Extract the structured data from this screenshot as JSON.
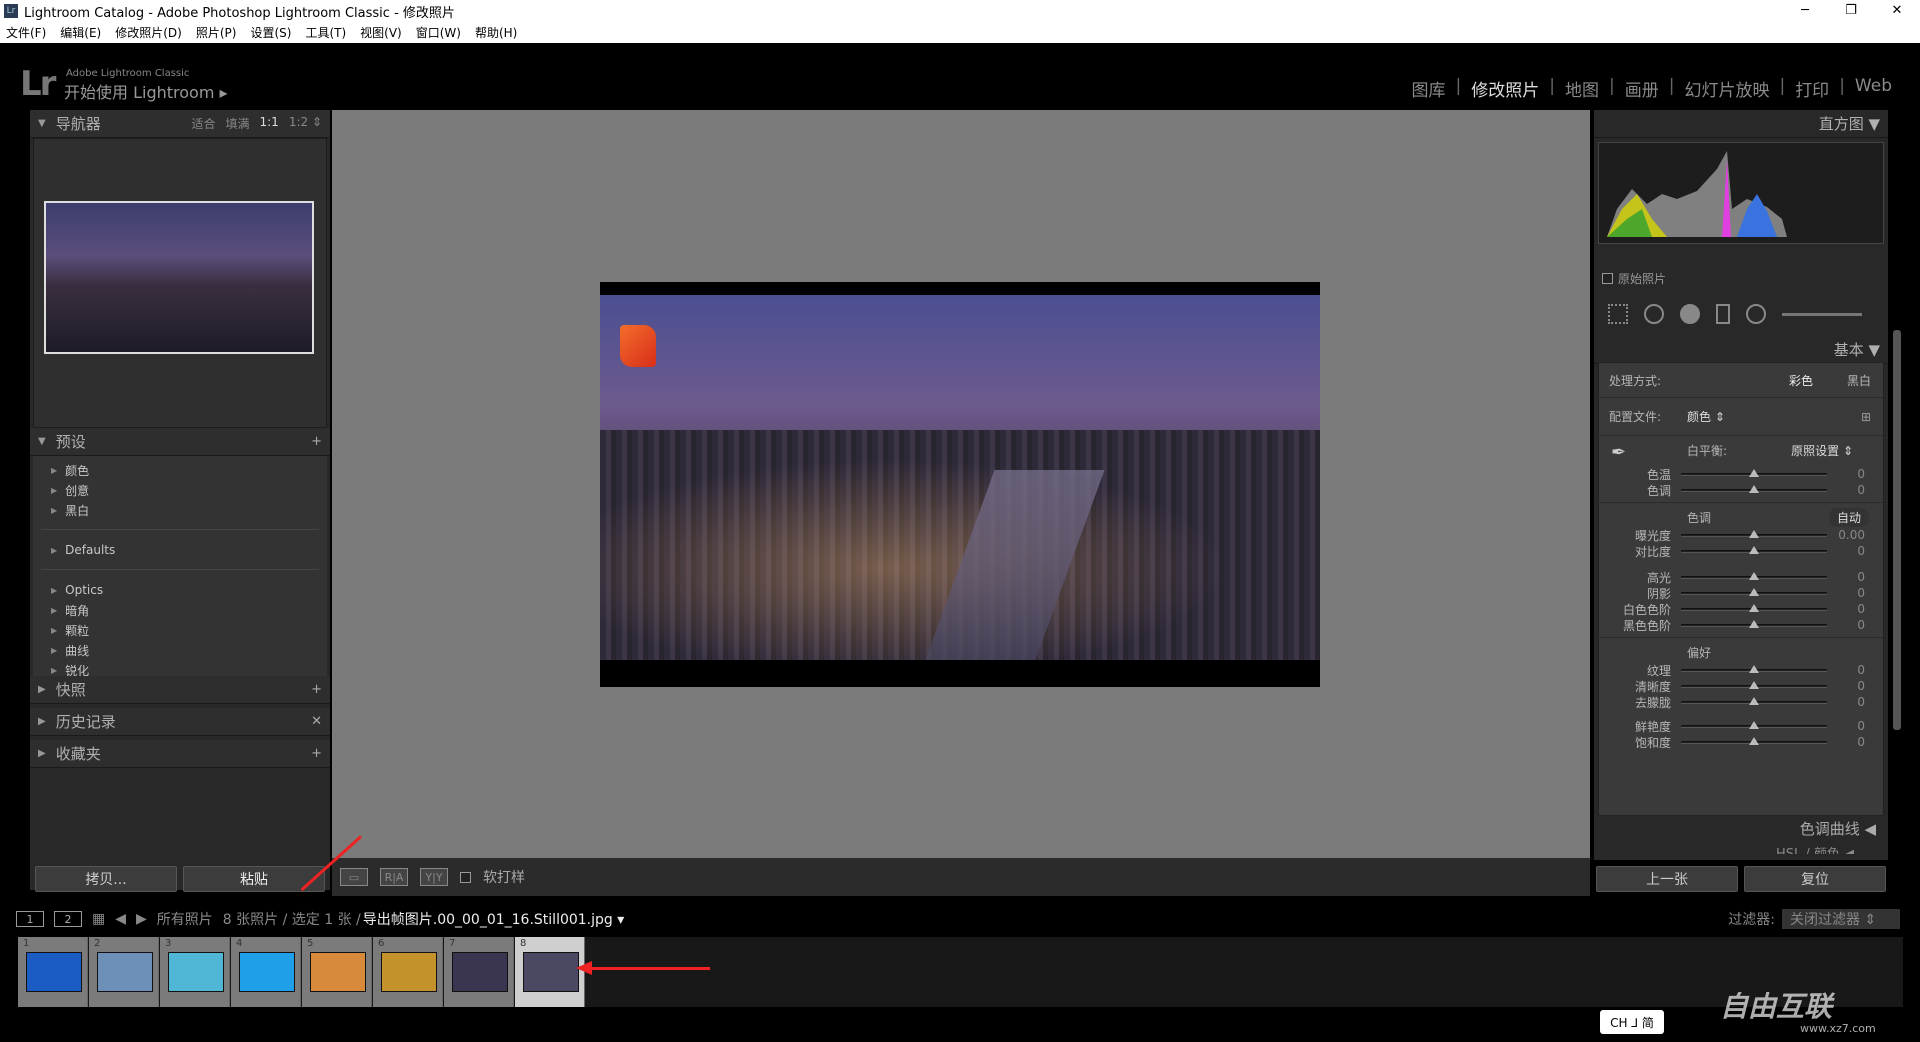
{
  "window": {
    "title": "Lightroom Catalog - Adobe Photoshop Lightroom Classic - 修改照片",
    "app_icon": "Lr",
    "controls": [
      "─",
      "❐",
      "✕"
    ]
  },
  "menu": [
    "文件(F)",
    "编辑(E)",
    "修改照片(D)",
    "照片(P)",
    "设置(S)",
    "工具(T)",
    "视图(V)",
    "窗口(W)",
    "帮助(H)"
  ],
  "header": {
    "logo": "Lr",
    "brand": "Adobe Lightroom Classic",
    "subtitle": "开始使用 Lightroom ▸",
    "modules": [
      "图库",
      "修改照片",
      "地图",
      "画册",
      "幻灯片放映",
      "打印",
      "Web"
    ],
    "active_module": "修改照片"
  },
  "left": {
    "navigator": {
      "title": "导航器",
      "options": [
        "适合",
        "填满",
        "1:1",
        "1:2 ⇕"
      ],
      "active_option": "1:1"
    },
    "presets": {
      "title": "预设",
      "add": "+",
      "groups1": [
        "颜色",
        "创意",
        "黑白"
      ],
      "groups2": [
        "Defaults"
      ],
      "groups3": [
        "Optics",
        "暗角",
        "颗粒",
        "曲线",
        "锐化"
      ]
    },
    "snapshots": {
      "title": "快照",
      "action": "+"
    },
    "history": {
      "title": "历史记录",
      "action": "✕"
    },
    "collections": {
      "title": "收藏夹",
      "action": "+"
    },
    "copy_button": "拷贝...",
    "paste_button": "粘贴"
  },
  "toolbar": {
    "view1": "▭",
    "view2": "R|A",
    "view3": "Y|Y",
    "soft_proof": "软打样"
  },
  "right": {
    "histogram": {
      "title": "直方图 ▼",
      "original_photo": "原始照片"
    },
    "basic": {
      "title": "基本 ▼",
      "treatment_label": "处理方式:",
      "treatment_color": "彩色",
      "treatment_bw": "黑白",
      "profile_label": "配置文件:",
      "profile_value": "颜色 ⇕",
      "wb_label": "白平衡:",
      "wb_value": "原照设置 ⇕",
      "tone_label": "色调",
      "auto": "自动",
      "presence_label": "偏好",
      "wb_sliders": [
        {
          "label": "色温",
          "value": "0",
          "pos": 0.5
        },
        {
          "label": "色调",
          "value": "0",
          "pos": 0.5
        }
      ],
      "tone_sliders1": [
        {
          "label": "曝光度",
          "value": "0.00",
          "pos": 0.5
        },
        {
          "label": "对比度",
          "value": "0",
          "pos": 0.5
        }
      ],
      "tone_sliders2": [
        {
          "label": "高光",
          "value": "0",
          "pos": 0.5
        },
        {
          "label": "阴影",
          "value": "0",
          "pos": 0.5
        },
        {
          "label": "白色色阶",
          "value": "0",
          "pos": 0.5
        },
        {
          "label": "黑色色阶",
          "value": "0",
          "pos": 0.5
        }
      ],
      "presence_sliders1": [
        {
          "label": "纹理",
          "value": "0",
          "pos": 0.5
        },
        {
          "label": "清晰度",
          "value": "0",
          "pos": 0.5
        },
        {
          "label": "去朦胧",
          "value": "0",
          "pos": 0.5
        }
      ],
      "presence_sliders2": [
        {
          "label": "鲜艳度",
          "value": "0",
          "pos": 0.5
        },
        {
          "label": "饱和度",
          "value": "0",
          "pos": 0.5
        }
      ]
    },
    "tone_curve": "色调曲线 ◀",
    "hsl": "HSL / 颜色 ◀",
    "prev_button": "上一张",
    "reset_button": "复位"
  },
  "filmstrip": {
    "screen1": "1",
    "screen2": "2",
    "source": "所有照片",
    "count": "8 张照片 / 选定 1 张 /",
    "filename": "导出帧图片.00_00_01_16.Still001.jpg ▾",
    "filter_label": "过滤器:",
    "filter_value": "关闭过滤器 ⇕",
    "items": [
      {
        "n": "1",
        "bg": "#1b5cc4"
      },
      {
        "n": "2",
        "bg": "#6d8fb8"
      },
      {
        "n": "3",
        "bg": "#4fb6d6"
      },
      {
        "n": "4",
        "bg": "#1e9fe8"
      },
      {
        "n": "5",
        "bg": "#d88a3c"
      },
      {
        "n": "6",
        "bg": "#c4922a"
      },
      {
        "n": "7",
        "bg": "#3a3550"
      },
      {
        "n": "8",
        "bg": "#4a4862"
      }
    ],
    "selected": "8"
  },
  "ime": "CH ⅃ 简",
  "watermark": {
    "text": "自由互联",
    "url": "www.xz7.com"
  }
}
